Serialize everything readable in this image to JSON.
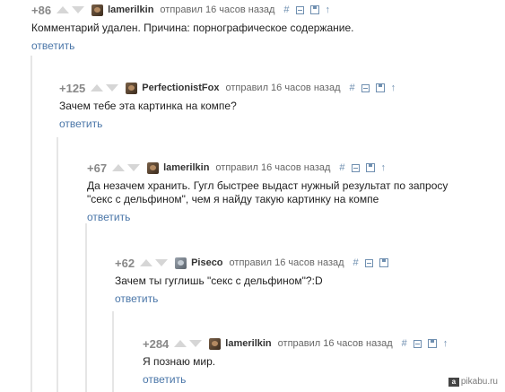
{
  "ui": {
    "reply_label": "ответить",
    "hash_icon": "#",
    "up_arrow": "↑",
    "colors": {
      "link": "#4a76a8",
      "tool": "#6f8fb0",
      "vote": "#d6d6d6",
      "branch": "#e6e6e6"
    }
  },
  "comments": [
    {
      "score": "+86",
      "user": "lamerilkin",
      "meta": "отправил 16 часов назад",
      "text": [
        "Комментарий удален. Причина: порнографическое содержание."
      ]
    },
    {
      "score": "+125",
      "user": "PerfectionistFox",
      "meta": "отправил 16 часов назад",
      "text": [
        "Зачем тебе эта картинка на компе?"
      ]
    },
    {
      "score": "+67",
      "user": "lamerilkin",
      "meta": "отправил 16 часов назад",
      "text": [
        "Да незачем хранить. Гугл быстрее выдаст нужный результат по запросу",
        "\"секс с дельфином\", чем я найду такую картинку на компе"
      ]
    },
    {
      "score": "+62",
      "user": "Piseco",
      "meta": "отправил 16 часов назад",
      "text": [
        "Зачем ты гуглишь \"секс с дельфином\"?:D"
      ]
    },
    {
      "score": "+284",
      "user": "lamerilkin",
      "meta": "отправил 16 часов назад",
      "text": [
        "Я познаю мир."
      ]
    }
  ],
  "watermark": {
    "text": "pikabu.ru",
    "logo": "a"
  }
}
